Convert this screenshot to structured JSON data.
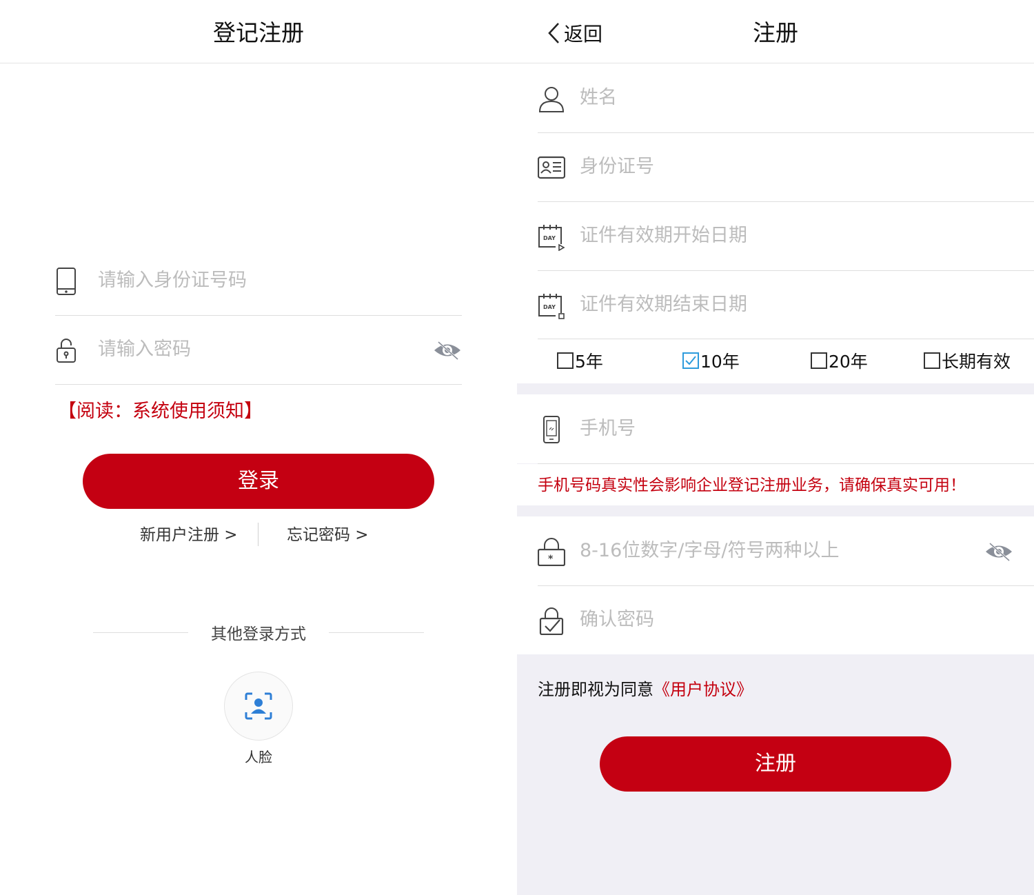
{
  "left": {
    "title": "登记注册",
    "id_placeholder": "请输入身份证号码",
    "password_placeholder": "请输入密码",
    "notice": "【阅读：系统使用须知】",
    "login_label": "登录",
    "register_link": "新用户注册 >",
    "forgot_link": "忘记密码 >",
    "other_login_label": "其他登录方式",
    "face_label": "人脸",
    "icons": [
      "phone-icon",
      "lock-icon",
      "eye-hidden-icon",
      "face-scan-icon"
    ]
  },
  "right": {
    "back_label": "返回",
    "title": "注册",
    "name_placeholder": "姓名",
    "idno_placeholder": "身份证号",
    "start_date_placeholder": "证件有效期开始日期",
    "end_date_placeholder": "证件有效期结束日期",
    "periods": [
      {
        "label": "5年",
        "checked": false
      },
      {
        "label": "10年",
        "checked": true
      },
      {
        "label": "20年",
        "checked": false
      },
      {
        "label": "长期有效",
        "checked": false
      }
    ],
    "phone_placeholder": "手机号",
    "phone_tip": "手机号码真实性会影响企业登记注册业务，请确保真实可用！",
    "password_placeholder": "8-16位数字/字母/符号两种以上",
    "confirm_placeholder": "确认密码",
    "agree_prefix": "注册即视为同意",
    "agree_link": "《用户协议》",
    "register_label": "注册",
    "icons": [
      "back-chevron-icon",
      "user-icon",
      "id-card-icon",
      "calendar-start-icon",
      "calendar-end-icon",
      "mobile-icon",
      "lock-star-icon",
      "lock-check-icon",
      "eye-hidden-icon"
    ]
  },
  "colors": {
    "accent_red": "#c40012",
    "checkbox_blue": "#2d9bdc",
    "face_blue": "#2e7fd6",
    "page_gray": "#f0eff5",
    "placeholder_gray": "#bcbcbc"
  }
}
